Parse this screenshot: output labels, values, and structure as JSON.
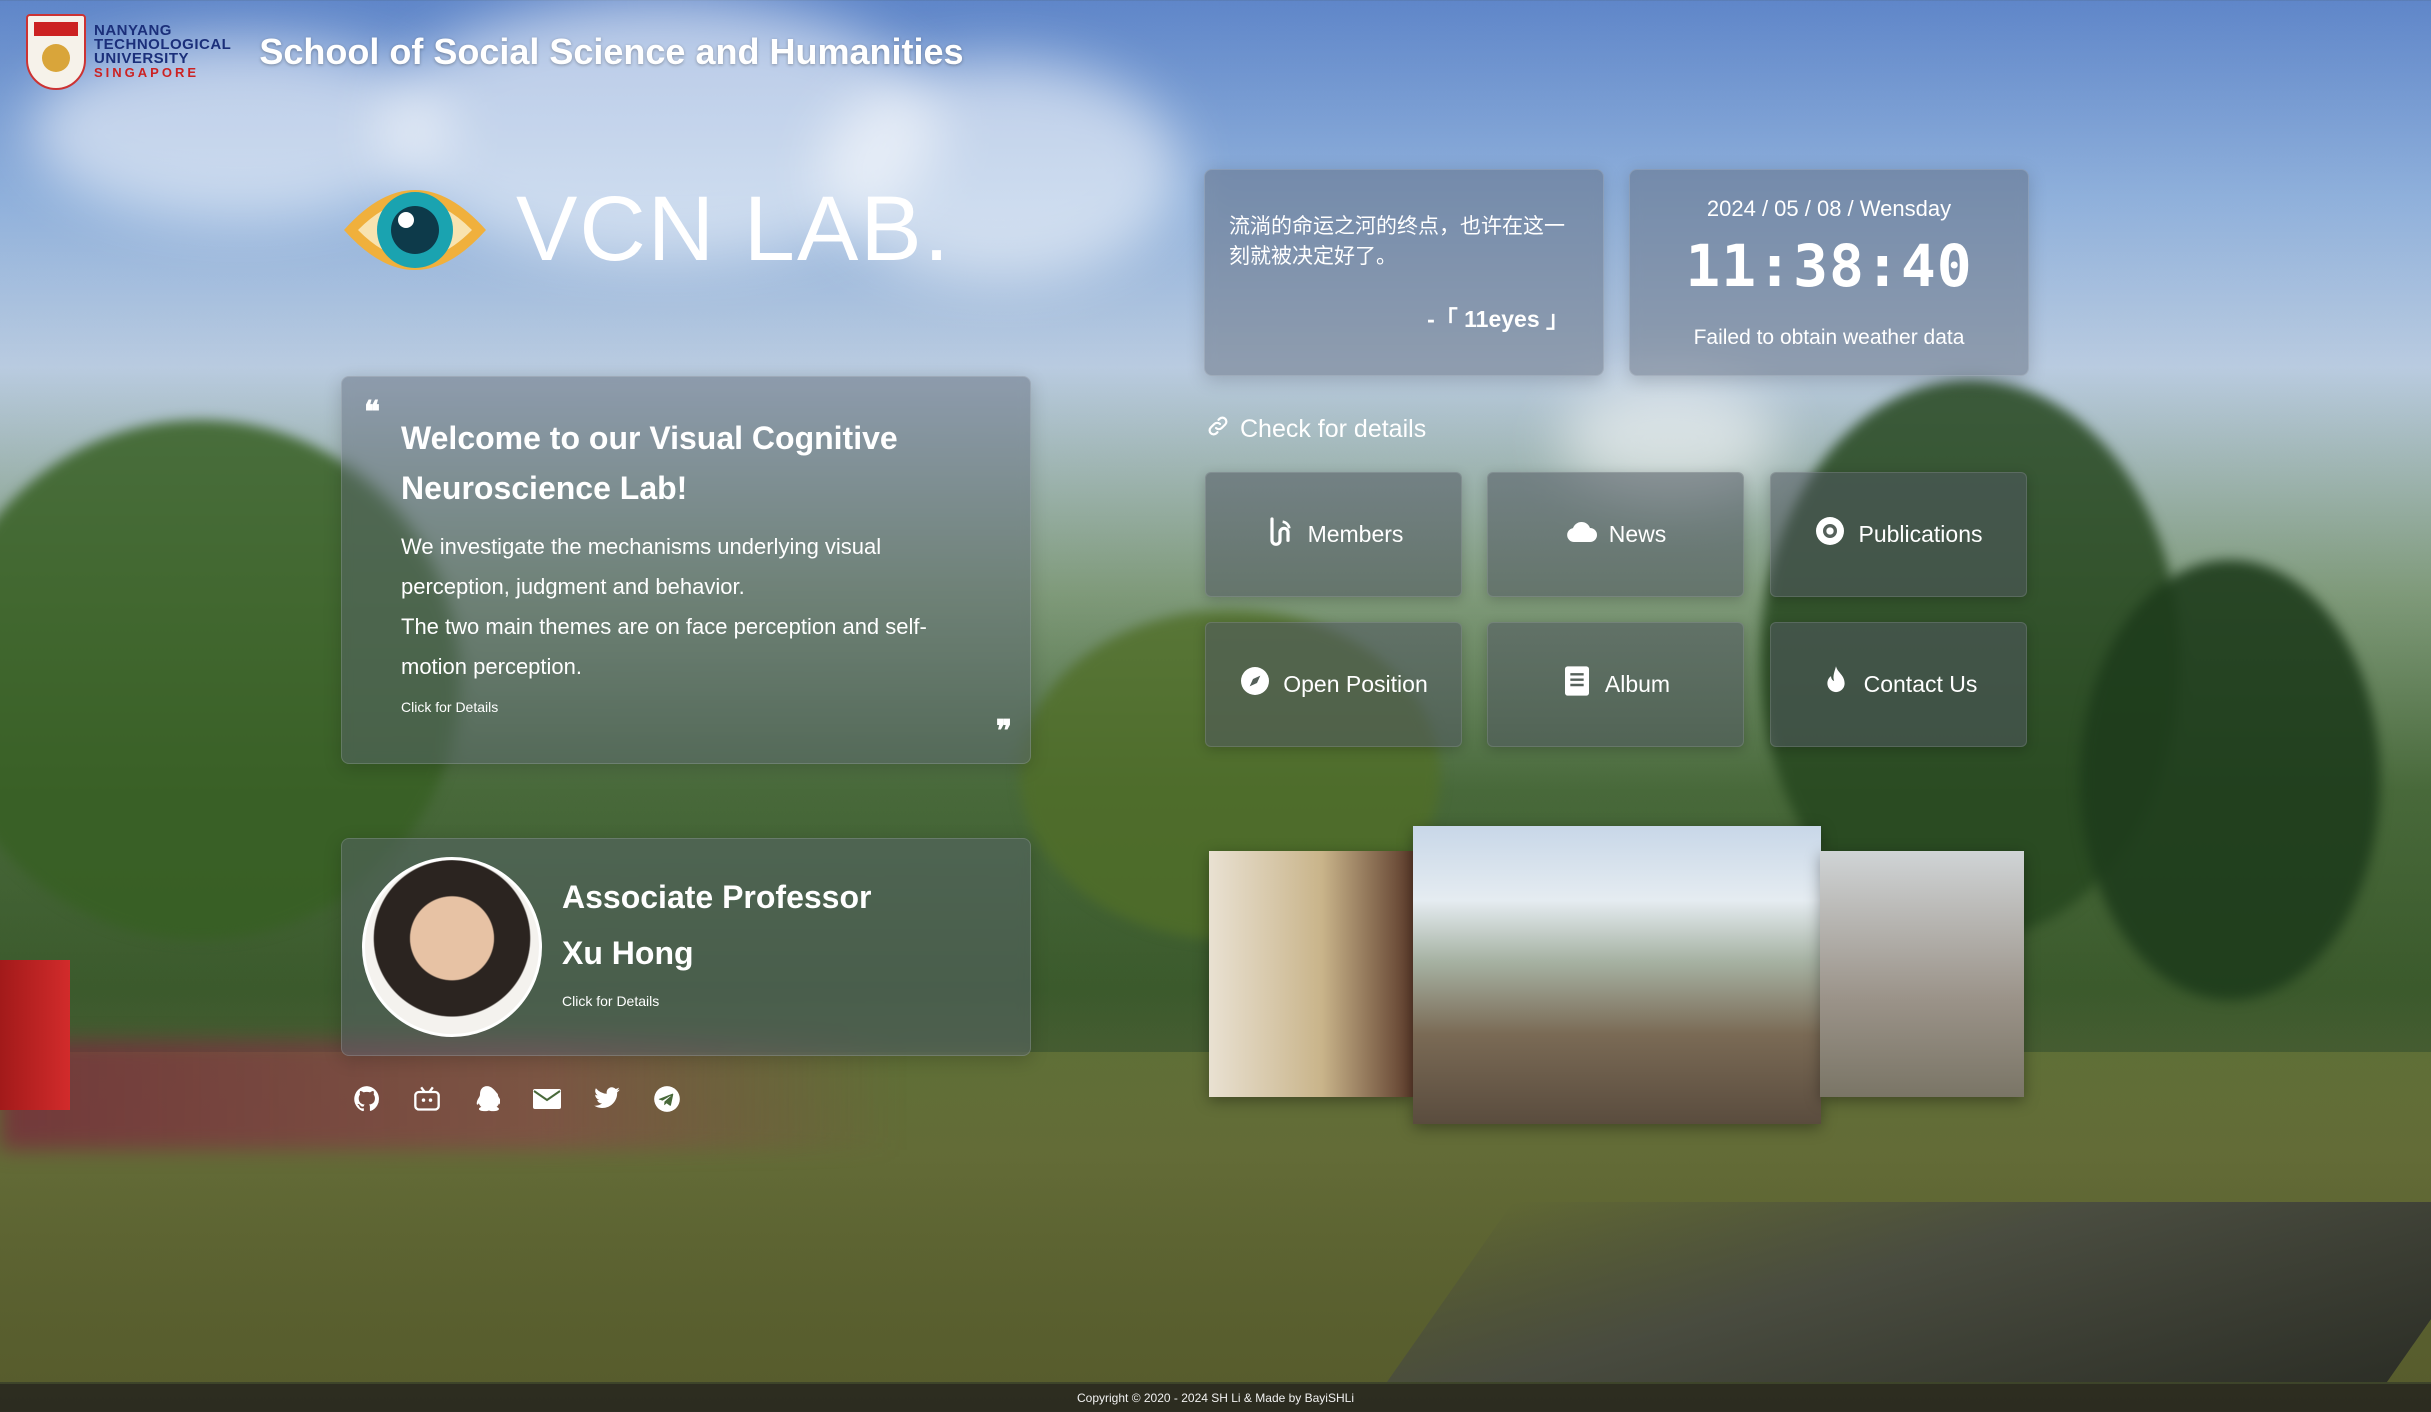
{
  "header": {
    "ntu_lines": [
      "NANYANG",
      "TECHNOLOGICAL",
      "UNIVERSITY",
      "SINGAPORE"
    ],
    "school_title": "School of Social Science and Humanities"
  },
  "lab": {
    "title": "VCN LAB."
  },
  "welcome": {
    "heading": "Welcome to our Visual Cognitive Neuroscience Lab!",
    "line1": "We investigate the mechanisms underlying visual perception, judgment and behavior.",
    "line2": "The two main themes are on face perception and self-motion perception.",
    "details": "Click for Details"
  },
  "professor": {
    "title": "Associate Professor",
    "name": "Xu Hong",
    "details": "Click for Details"
  },
  "socials": [
    "github-icon",
    "bilibili-icon",
    "qq-icon",
    "mail-icon",
    "twitter-icon",
    "telegram-icon"
  ],
  "quote": {
    "text": "流淌的命运之河的终点，也许在这一刻就被决定好了。",
    "source": "-「 11eyes 」"
  },
  "clock": {
    "date": "2024 / 05 / 08 /  Wensday",
    "time": "11:38:40",
    "weather": "Failed to obtain weather data"
  },
  "check_details": "Check for details",
  "buttons": {
    "members": "Members",
    "news": "News",
    "publications": "Publications",
    "open_position": "Open Position",
    "album": "Album",
    "contact": "Contact Us"
  },
  "footer": "Copyright © 2020 - 2024 SH Li & Made by BayiSHLi"
}
